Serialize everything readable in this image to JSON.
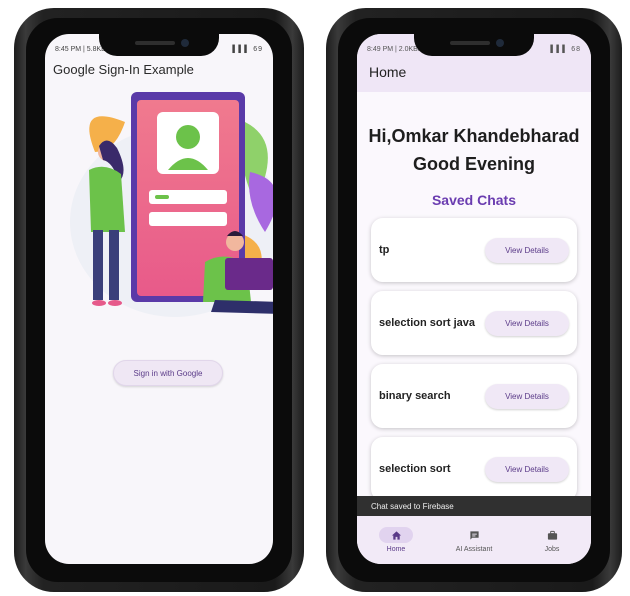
{
  "left_phone": {
    "status_time": "8:45 PM | 5.8KB/s",
    "status_right": "▌▌▌ 69",
    "app_title": "Google Sign-In Example",
    "signin_label": "Sign in with Google"
  },
  "right_phone": {
    "status_time": "8:49 PM | 2.0KB/s",
    "status_right": "▌▌▌ 68",
    "appbar_title": "Home",
    "greeting_line1": "Hi,Omkar Khandebharad",
    "greeting_line2": "Good Evening",
    "section_title": "Saved Chats",
    "chats": [
      {
        "title": "tp",
        "button": "View Details"
      },
      {
        "title": "selection sort java",
        "button": "View Details"
      },
      {
        "title": "binary search",
        "button": "View Details"
      },
      {
        "title": "selection sort",
        "button": "View Details"
      }
    ],
    "snackbar": "Chat saved to Firebase",
    "nav": [
      {
        "label": "Home",
        "icon": "home-icon",
        "active": true
      },
      {
        "label": "AI Assistant",
        "icon": "chat-icon",
        "active": false
      },
      {
        "label": "Jobs",
        "icon": "briefcase-icon",
        "active": false
      }
    ]
  },
  "colors": {
    "accent": "#6a3cb0",
    "button_bg": "#f0e8f6",
    "appbar_bg": "#efe6f6"
  }
}
